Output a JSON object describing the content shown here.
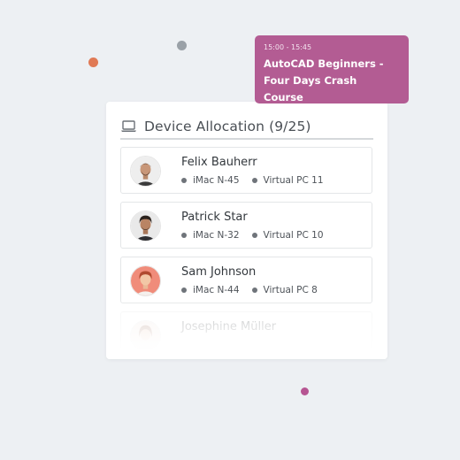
{
  "allocation": {
    "title": "Device Allocation (9/25)",
    "icon": "laptop-icon",
    "users": [
      {
        "name": "Felix Bauherr",
        "device": "iMac N-45",
        "virtual_pc": "Virtual PC 11",
        "avatar": "avatar-felix"
      },
      {
        "name": "Patrick Star",
        "device": "iMac N-32",
        "virtual_pc": "Virtual PC 10",
        "avatar": "avatar-patrick"
      },
      {
        "name": "Sam Johnson",
        "device": "iMac N-44",
        "virtual_pc": "Virtual PC 8",
        "avatar": "avatar-sam"
      },
      {
        "name": "Josephine Müller",
        "avatar": "avatar-josephine"
      }
    ]
  },
  "event": {
    "time": "15:00 - 15:45",
    "title_line1": "AutoCAD Beginners -",
    "title_line2": "Four Days Crash Course",
    "color": "#b35c93"
  },
  "colors": {
    "background": "#edf0f3",
    "dot_orange": "#e07a55",
    "dot_gray": "#9aa1a7",
    "dot_pink": "#b65592"
  }
}
